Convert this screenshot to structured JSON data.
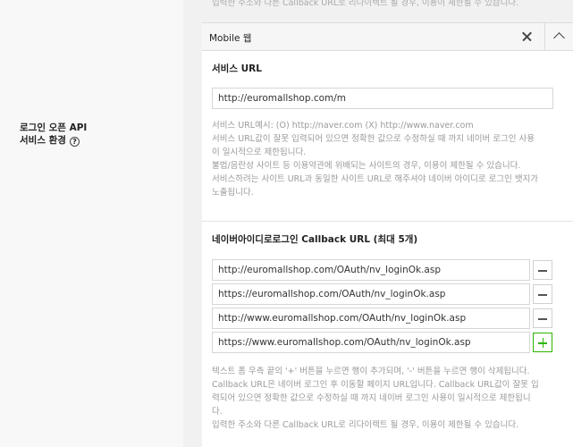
{
  "left": {
    "label_line1": "로그인 오픈 API",
    "label_line2": "서비스 환경",
    "help_icon": "?"
  },
  "top_note": "입력한 주소와 다른 Callback URL로 리다이렉트 될 경우, 이용이 제한될 수 있습니다.",
  "panel": {
    "title": "Mobile 웹",
    "close_icon": "close-icon",
    "collapse_icon": "chevron-up-icon"
  },
  "service_url": {
    "title": "서비스 URL",
    "value": "http://euromallshop.com/m",
    "help": [
      "서비스 URL예시: (O) http://naver.com (X) http://www.naver.com",
      "서비스 URL값이 잘못 입력되어 있으면 정확한 값으로 수정하실 때 까지 네이버 로그인 사용",
      "이 일시적으로 제한됩니다.",
      "불법/음란성 사이트 등 이용약관에 위배되는 사이트의 경우, 이용이 제한될 수 있습니다.",
      "서비스하려는 사이트 URL과 동일한 사이트 URL로 해주셔야 네이버 아이디로 로그인 뱃지가",
      "노출됩니다."
    ]
  },
  "callback": {
    "title": "네이버아이디로로그인 Callback URL (최대 5개)",
    "urls": [
      "http://euromallshop.com/OAuth/nv_loginOk.asp",
      "https://euromallshop.com/OAuth/nv_loginOk.asp",
      "http://www.euromallshop.com/OAuth/nv_loginOk.asp",
      "https://www.euromallshop.com/OAuth/nv_loginOk.asp"
    ],
    "help": [
      "텍스트 폼 우측 끝의 '+' 버튼을 누르면 행이 추가되며, '-' 버튼을 누르면 행이 삭제됩니다.",
      "Callback URL은 네이버 로그인 후 이동할 페이지 URL입니다. Callback URL값이 잘못 입",
      "력되어 있으면 정확한 값으로 수정하실 때 까지 네이버 로그인 사용이 일시적으로 제한됩니",
      "다.",
      "입력한 주소와 다른 Callback URL로 리다이렉트 될 경우, 이용이 제한될 수 있습니다."
    ]
  },
  "colors": {
    "accent_green": "#2db400",
    "help_text": "#9a9a9a"
  }
}
